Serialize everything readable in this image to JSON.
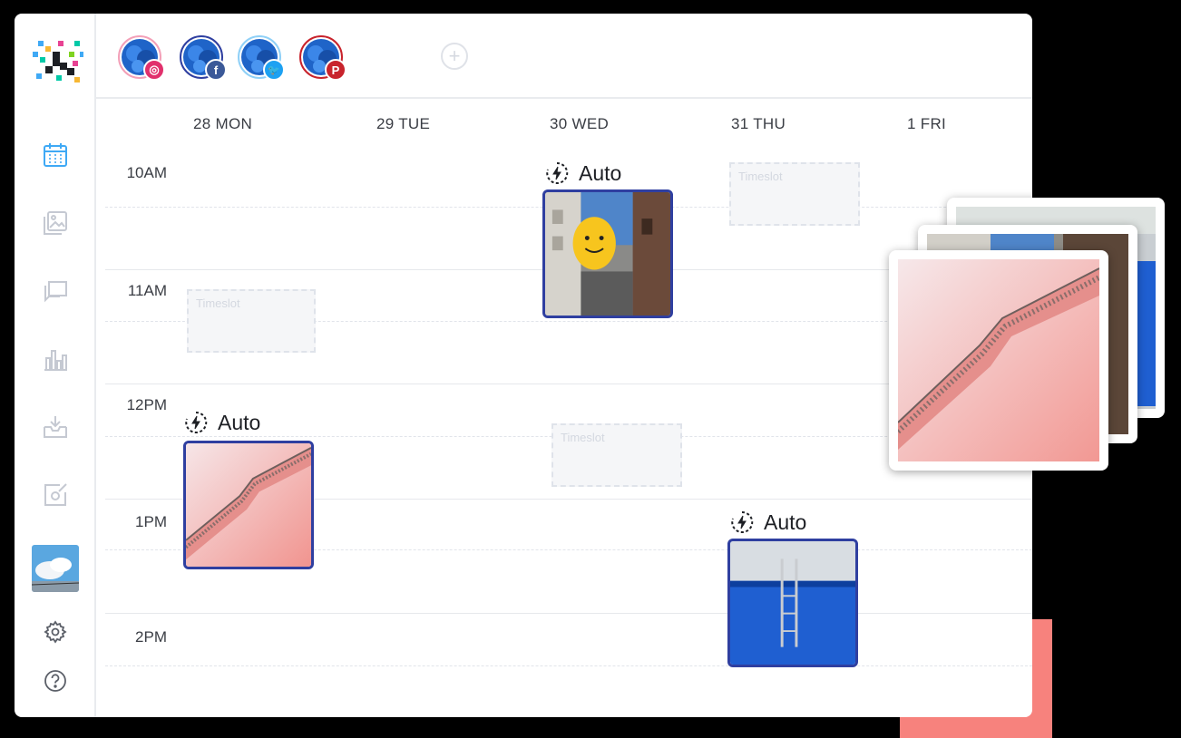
{
  "colors": {
    "accent_blue": "#3fa9f5",
    "post_border": "#2f3fa0",
    "coral": "#f7827d",
    "instagram": "#e1306c",
    "facebook": "#3b5998",
    "twitter": "#1da1f2",
    "pinterest": "#c8232c"
  },
  "sidebar": {
    "logo": "brand-logo",
    "items": [
      {
        "icon": "calendar-icon",
        "active": true
      },
      {
        "icon": "image-gallery-icon",
        "active": false
      },
      {
        "icon": "chat-bubbles-icon",
        "active": false
      },
      {
        "icon": "bar-chart-icon",
        "active": false
      },
      {
        "icon": "inbox-download-icon",
        "active": false
      },
      {
        "icon": "edit-check-icon",
        "active": false
      }
    ],
    "thumbnail": "sky-thumbnail",
    "settings_icon": "gear-icon",
    "help_icon": "question-circle-icon"
  },
  "accounts": [
    {
      "network": "instagram",
      "glyph": "◎"
    },
    {
      "network": "facebook",
      "glyph": "f"
    },
    {
      "network": "twitter",
      "glyph": "🐦"
    },
    {
      "network": "pinterest",
      "glyph": "P"
    }
  ],
  "add_account_label": "+",
  "calendar": {
    "days": [
      "28 MON",
      "29 TUE",
      "30 WED",
      "31 THU",
      "1 FRI"
    ],
    "times": [
      "10AM",
      "11AM",
      "12PM",
      "1PM",
      "2PM"
    ],
    "timeslot_label": "Timeslot",
    "auto_label": "Auto"
  }
}
